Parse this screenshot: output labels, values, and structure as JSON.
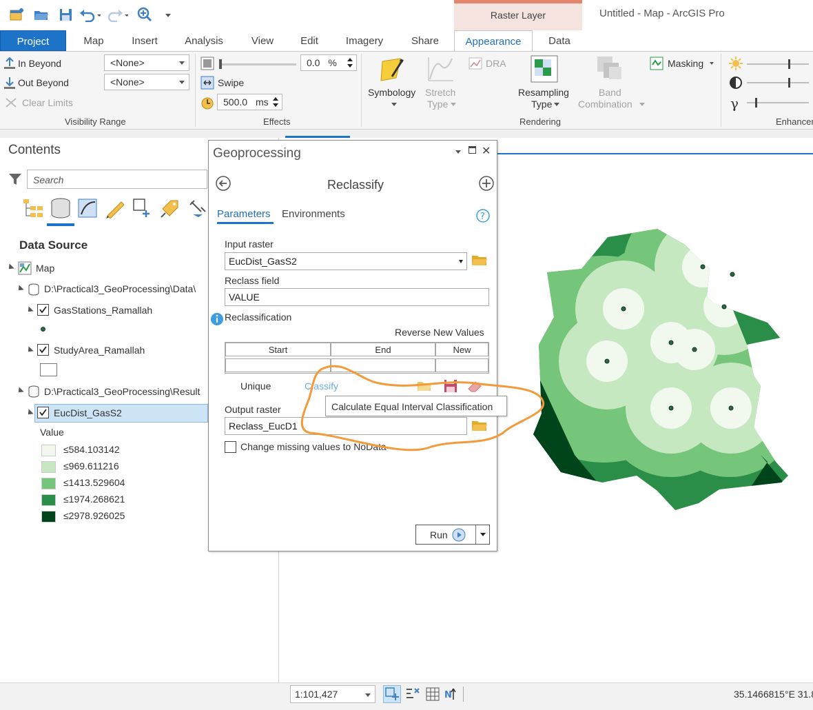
{
  "context_tab": "Raster Layer",
  "app_title": "Untitled - Map - ArcGIS Pro",
  "tabs": [
    "Project",
    "Map",
    "Insert",
    "Analysis",
    "View",
    "Edit",
    "Imagery",
    "Share",
    "Appearance",
    "Data"
  ],
  "ribbon": {
    "visibility": {
      "in_beyond": "In Beyond",
      "out_beyond": "Out Beyond",
      "clear_limits": "Clear Limits",
      "none1": "<None>",
      "none2": "<None>",
      "group": "Visibility Range"
    },
    "effects": {
      "transparency": "0.0",
      "pct": "%",
      "swipe": "Swipe",
      "flicker": "500.0",
      "ms": "ms",
      "group": "Effects"
    },
    "rendering": {
      "symbology": "Symbology",
      "stretch": "Stretch",
      "stretch2": "Type",
      "dra": "DRA",
      "resampling": "Resampling",
      "resampling2": "Type",
      "band": "Band",
      "band2": "Combination",
      "masking": "Masking",
      "group": "Rendering"
    },
    "enhance_group": "Enhancer"
  },
  "contents": {
    "title": "Contents",
    "search_placeholder": "Search",
    "heading": "Data Source",
    "map": "Map",
    "folder1": "D:\\Practical3_GeoProcessing\\Data\\",
    "layer1": "GasStations_Ramallah",
    "layer2": "StudyArea_Ramallah",
    "folder2": "D:\\Practical3_GeoProcessing\\Result",
    "layer3": "EucDist_GasS2",
    "value_label": "Value",
    "legend": [
      {
        "label": "≤584.103142",
        "color": "#f1f9ef"
      },
      {
        "label": "≤969.611216",
        "color": "#c6e8c1"
      },
      {
        "label": "≤1413.529604",
        "color": "#75c57a"
      },
      {
        "label": "≤1974.268621",
        "color": "#2a8d48"
      },
      {
        "label": "≤2978.926025",
        "color": "#00441b"
      }
    ]
  },
  "geoprocessing": {
    "title": "Geoprocessing",
    "tool": "Reclassify",
    "tab_parameters": "Parameters",
    "tab_environments": "Environments",
    "input_raster_label": "Input raster",
    "input_raster_value": "EucDist_GasS2",
    "reclass_field_label": "Reclass field",
    "reclass_field_value": "VALUE",
    "reclassification_label": "Reclassification",
    "reverse": "Reverse New Values",
    "col_start": "Start",
    "col_end": "End",
    "col_new": "New",
    "unique": "Unique",
    "classify": "Classify",
    "tooltip": "Calculate Equal Interval Classification",
    "output_raster_label": "Output raster",
    "output_raster_value": "Reclass_EucD1",
    "nodata_label": "Change missing values to NoData",
    "run": "Run"
  },
  "status": {
    "scale": "1:101,427",
    "coords": "35.1466815°E 31.8"
  },
  "colors": {
    "accent": "#1c73c8",
    "annotation": "#f39a3a"
  }
}
